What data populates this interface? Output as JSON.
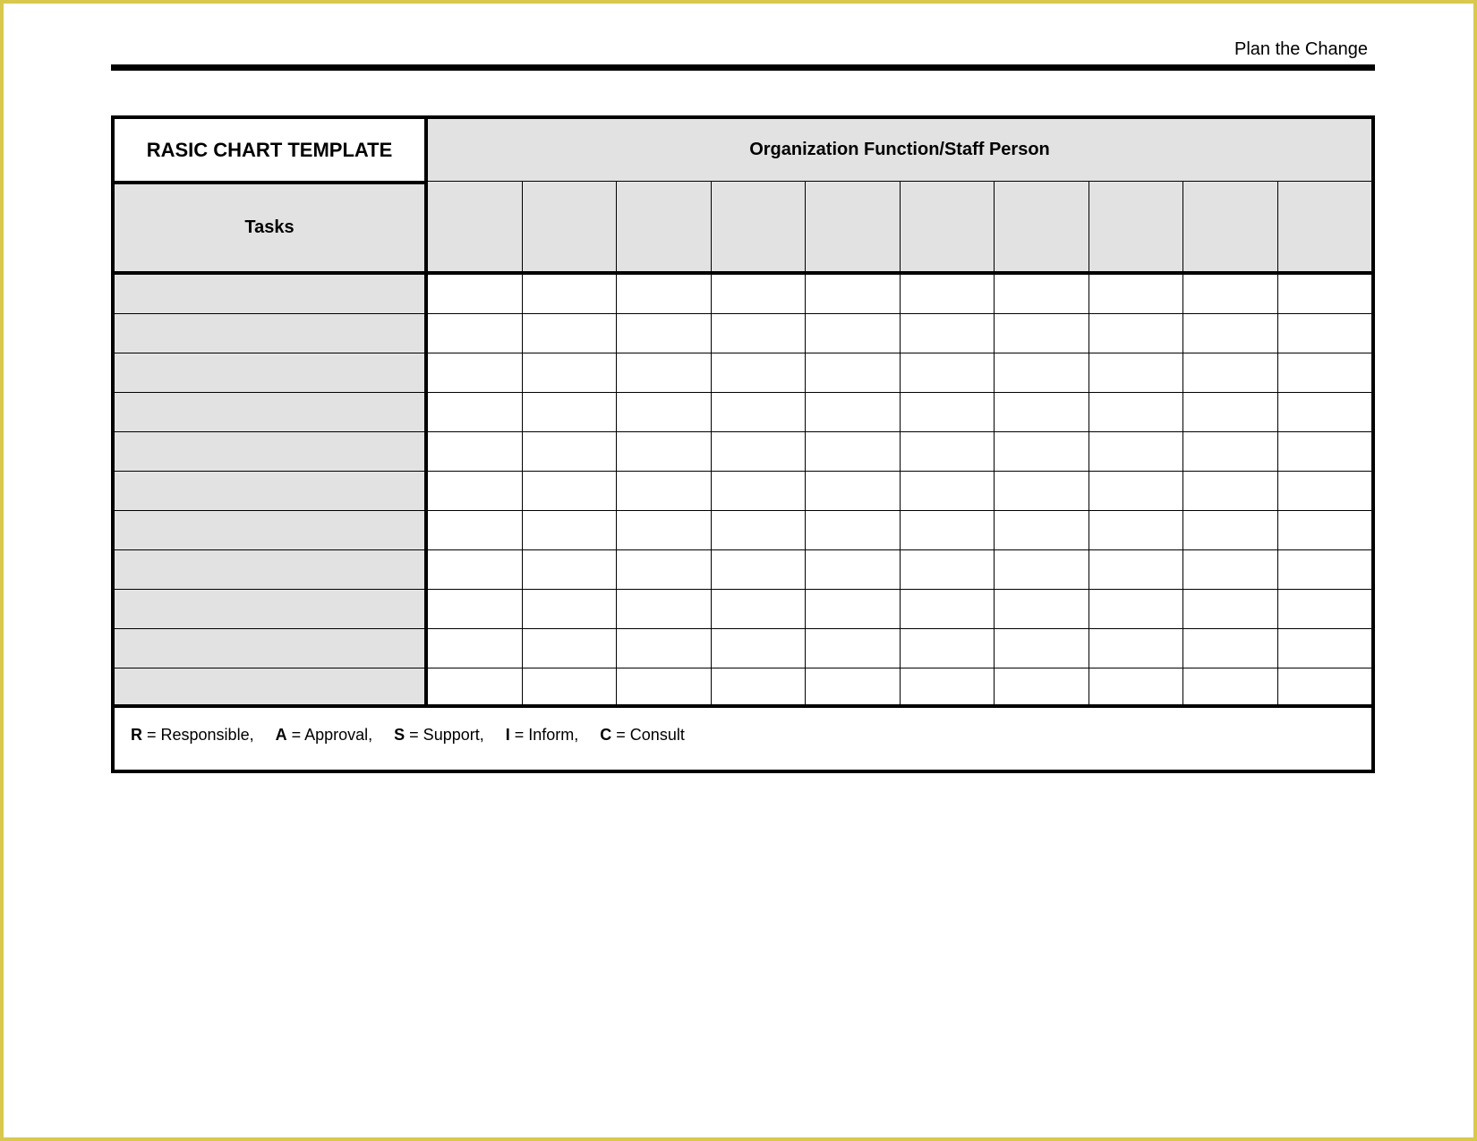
{
  "header_label": "Plan the Change",
  "main_title": "RASIC CHART TEMPLATE",
  "org_header": "Organization Function/Staff Person",
  "tasks_header": "Tasks",
  "legend": [
    {
      "key": "R",
      "text": " = Responsible,"
    },
    {
      "key": "A",
      "text": " = Approval,"
    },
    {
      "key": "S",
      "text": " = Support,"
    },
    {
      "key": "I",
      "text": " = Inform,"
    },
    {
      "key": "C",
      "text": " = Consult"
    }
  ],
  "chart_data": {
    "type": "table",
    "title": "RASIC CHART TEMPLATE",
    "staff_columns": [
      "",
      "",
      "",
      "",
      "",
      "",
      "",
      "",
      "",
      ""
    ],
    "tasks": [
      {
        "name": "",
        "assignments": [
          "",
          "",
          "",
          "",
          "",
          "",
          "",
          "",
          "",
          ""
        ]
      },
      {
        "name": "",
        "assignments": [
          "",
          "",
          "",
          "",
          "",
          "",
          "",
          "",
          "",
          ""
        ]
      },
      {
        "name": "",
        "assignments": [
          "",
          "",
          "",
          "",
          "",
          "",
          "",
          "",
          "",
          ""
        ]
      },
      {
        "name": "",
        "assignments": [
          "",
          "",
          "",
          "",
          "",
          "",
          "",
          "",
          "",
          ""
        ]
      },
      {
        "name": "",
        "assignments": [
          "",
          "",
          "",
          "",
          "",
          "",
          "",
          "",
          "",
          ""
        ]
      },
      {
        "name": "",
        "assignments": [
          "",
          "",
          "",
          "",
          "",
          "",
          "",
          "",
          "",
          ""
        ]
      },
      {
        "name": "",
        "assignments": [
          "",
          "",
          "",
          "",
          "",
          "",
          "",
          "",
          "",
          ""
        ]
      },
      {
        "name": "",
        "assignments": [
          "",
          "",
          "",
          "",
          "",
          "",
          "",
          "",
          "",
          ""
        ]
      },
      {
        "name": "",
        "assignments": [
          "",
          "",
          "",
          "",
          "",
          "",
          "",
          "",
          "",
          ""
        ]
      },
      {
        "name": "",
        "assignments": [
          "",
          "",
          "",
          "",
          "",
          "",
          "",
          "",
          "",
          ""
        ]
      },
      {
        "name": "",
        "assignments": [
          "",
          "",
          "",
          "",
          "",
          "",
          "",
          "",
          "",
          ""
        ]
      }
    ],
    "legend": {
      "R": "Responsible",
      "A": "Approval",
      "S": "Support",
      "I": "Inform",
      "C": "Consult"
    }
  }
}
